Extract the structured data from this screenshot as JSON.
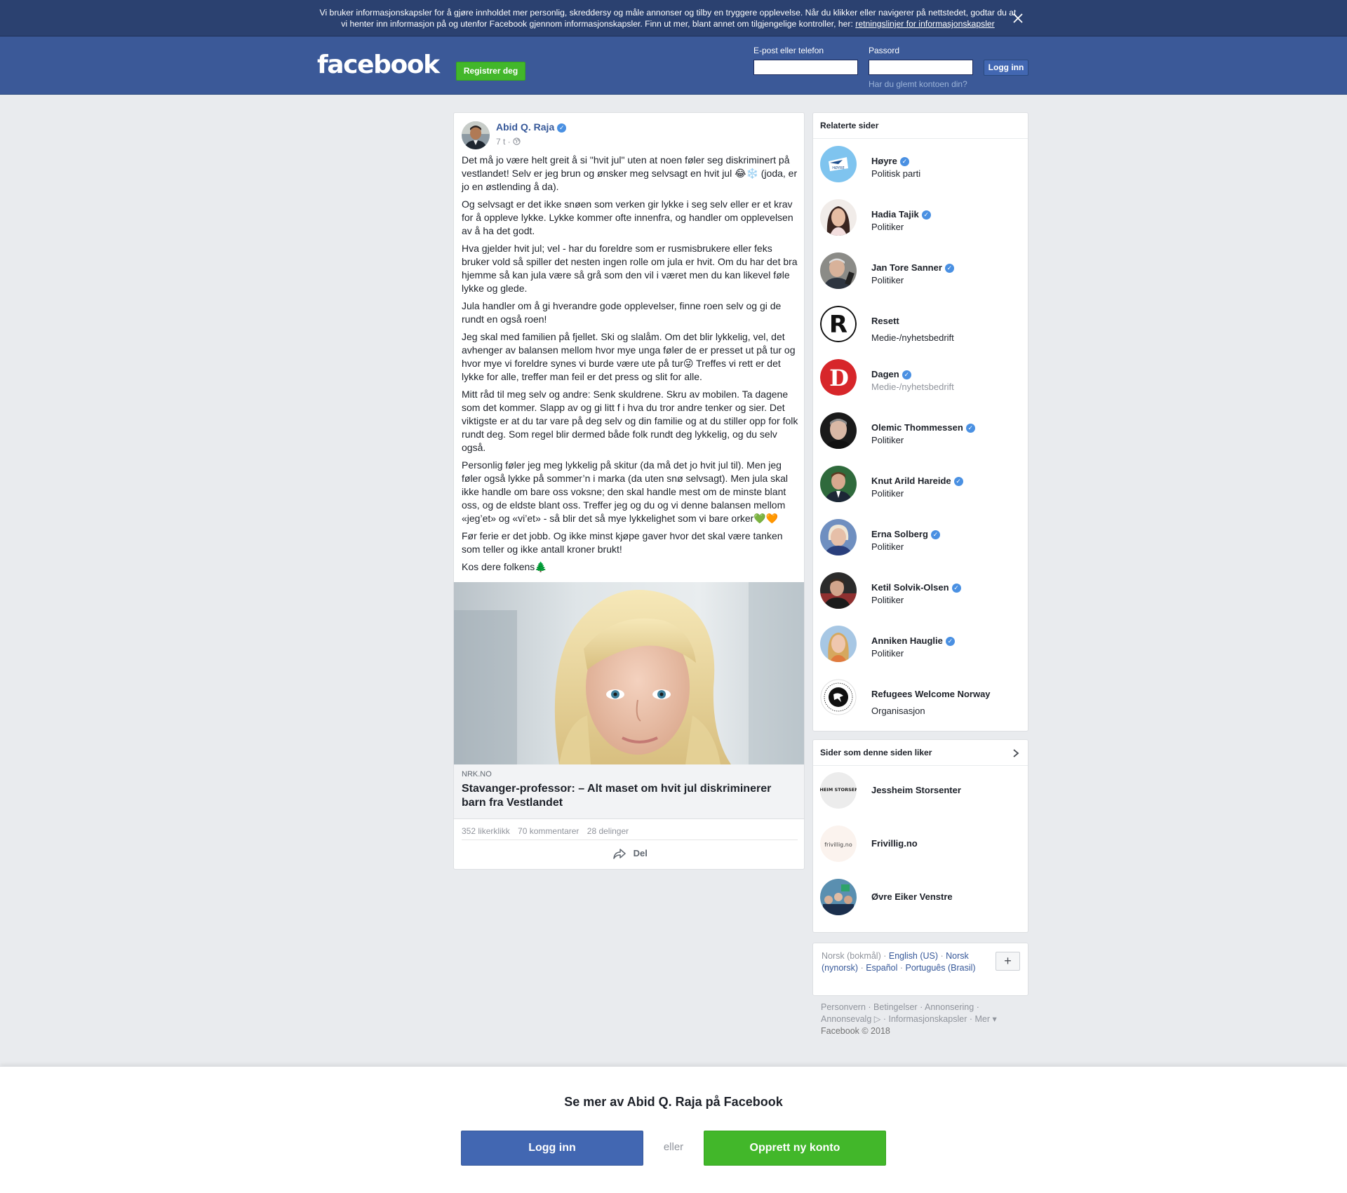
{
  "cookie_banner": {
    "text": "Vi bruker informasjonskapsler for å gjøre innholdet mer personlig, skreddersy og måle annonser og tilby en tryggere opplevelse. Når du klikker eller navigerer på nettstedet, godtar du at vi henter inn informasjon på og utenfor Facebook gjennom informasjonskapsler. Finn ut mer, blant annet om tilgjengelige kontroller, her: ",
    "link": "retningslinjer for informasjonskapsler"
  },
  "header": {
    "logo": "facebook",
    "register_label": "Registrer deg",
    "email_label": "E-post eller telefon",
    "password_label": "Passord",
    "login_label": "Logg inn",
    "forgot_label": "Har du glemt kontoen din?"
  },
  "post": {
    "author": "Abid Q. Raja",
    "time": "7 t ·",
    "paragraphs": [
      "Det må jo være helt greit å si \"hvit jul\" uten at noen føler seg diskriminert på vestlandet! Selv er jeg brun og ønsker meg selvsagt en hvit jul 😂❄️ (joda, er jo en østlending å da).",
      "Og selvsagt er det ikke snøen som verken gir lykke i seg selv eller er et krav for å oppleve lykke. Lykke kommer ofte innenfra, og handler om opplevelsen av å ha det godt.",
      "Hva gjelder hvit jul; vel - har du foreldre som er rusmisbrukere eller feks bruker vold så spiller det nesten ingen rolle om jula er hvit. Om du har det bra hjemme så kan jula være så grå som den vil i været men du kan likevel føle lykke og glede.",
      "Jula handler om å gi hverandre gode opplevelser, finne roen selv og gi de rundt en også roen!",
      "Jeg skal med familien på fjellet. Ski og slalåm. Om det blir lykkelig, vel, det avhenger av balansen mellom hvor mye unga føler de er presset ut på tur og hvor mye vi foreldre synes vi burde være ute på tur😜 Treffes vi rett er det lykke for alle, treffer man feil er det press og slit for alle.",
      "Mitt råd til meg selv og andre: Senk skuldrene. Skru av mobilen. Ta dagene som det kommer. Slapp av og gi litt f i hva du tror andre tenker og sier. Det viktigste er at du tar vare på deg selv og din familie og at du stiller opp for folk rundt deg. Som regel blir dermed både folk rundt deg lykkelig, og du selv også.",
      "Personlig føler jeg meg lykkelig på skitur (da må det jo hvit jul til). Men jeg føler også lykke på sommer’n i marka (da uten snø selvsagt). Men jula skal ikke handle om bare oss voksne; den skal handle mest om de minste blant oss, og de eldste blant oss. Treffer jeg og du og vi denne balansen mellom «jeg’et» og «vi’et» - så blir det så mye lykkelighet som vi bare orker💚🧡",
      "Før ferie er det jobb. Og ikke minst kjøpe gaver hvor det skal være tanken som teller og ikke antall kroner brukt!",
      "Kos dere folkens🌲"
    ],
    "link_source": "NRK.NO",
    "link_title": "Stavanger-professor: – Alt maset om hvit jul diskriminerer barn fra Vestlandet",
    "likes": "352 likerklikk",
    "comments": "70 kommentarer",
    "shares": "28 delinger",
    "share_label": "Del"
  },
  "related": {
    "title": "Relaterte sider",
    "items": [
      {
        "name": "Høyre",
        "category": "Politisk parti",
        "verified": true
      },
      {
        "name": "Hadia Tajik",
        "category": "Politiker",
        "verified": true
      },
      {
        "name": "Jan Tore Sanner",
        "category": "Politiker",
        "verified": true
      },
      {
        "name": "Resett",
        "category": "Medie-/nyhetsbedrift",
        "verified": false
      },
      {
        "name": "Dagen",
        "category": "Medie-/nyhetsbedrift",
        "verified": true
      },
      {
        "name": "Olemic Thommessen",
        "category": "Politiker",
        "verified": true
      },
      {
        "name": "Knut Arild Hareide",
        "category": "Politiker",
        "verified": true
      },
      {
        "name": "Erna Solberg",
        "category": "Politiker",
        "verified": true
      },
      {
        "name": "Ketil Solvik-Olsen",
        "category": "Politiker",
        "verified": true
      },
      {
        "name": "Anniken Hauglie",
        "category": "Politiker",
        "verified": true
      },
      {
        "name": "Refugees Welcome Norway",
        "category": "Organisasjon",
        "verified": false
      }
    ]
  },
  "liked": {
    "title": "Sider som denne siden liker",
    "items": [
      {
        "name": "Jessheim Storsenter",
        "logo_text": "JESSHEIM STORSENTER"
      },
      {
        "name": "Frivillig.no",
        "logo_text": "frivillig.no"
      },
      {
        "name": "Øvre Eiker Venstre"
      }
    ]
  },
  "languages": {
    "current": "Norsk (bokmål)",
    "others": [
      "English (US)",
      "Norsk (nynorsk)",
      "Español",
      "Português (Brasil)"
    ]
  },
  "footer": {
    "links": [
      "Personvern",
      "Betingelser",
      "Annonsering",
      "Annonsevalg",
      "Informasjonskapsler",
      "Mer"
    ],
    "copyright": "Facebook © 2018"
  },
  "bottom_bar": {
    "title": "Se mer av Abid Q. Raja på Facebook",
    "login_label": "Logg inn",
    "or_label": "eller",
    "create_label": "Opprett ny konto"
  },
  "colors": {
    "brand_blue": "#3b5998",
    "button_blue": "#4267b2",
    "green": "#42b72a",
    "link_blue": "#365899",
    "verified_blue": "#4a90e2"
  }
}
